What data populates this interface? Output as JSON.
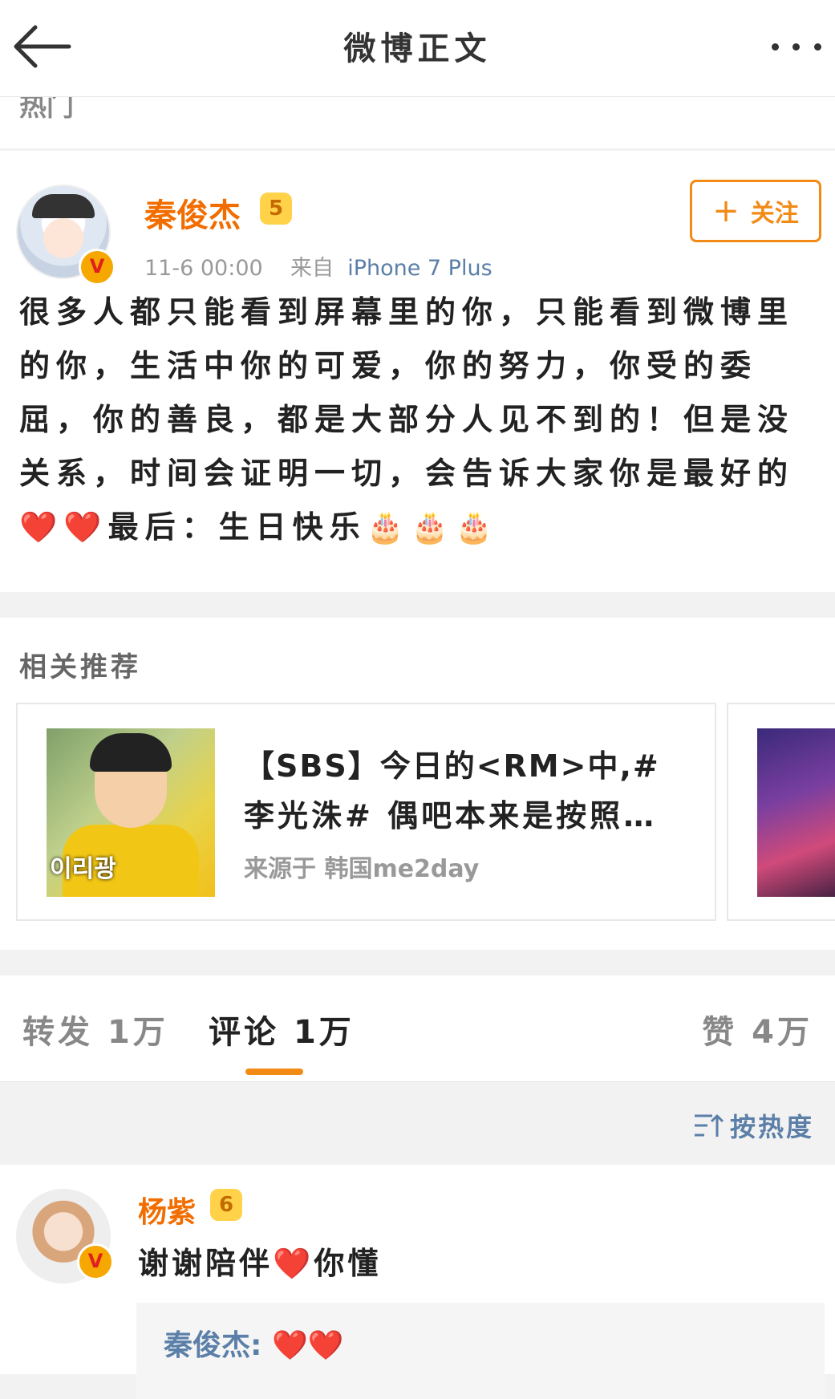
{
  "header": {
    "title": "微博正文"
  },
  "hot_label": "热门",
  "post": {
    "author": "秦俊杰",
    "vip_level": "5",
    "verified_mark": "V",
    "time": "11-6 00:00",
    "source_prefix": "来自",
    "source": "iPhone 7 Plus",
    "follow_label": "关注",
    "text": "很多人都只能看到屏幕里的你，只能看到微博里的你，生活中你的可爱，你的努力，你受的委屈，你的善良，都是大部分人见不到的！但是没关系，时间会证明一切，会告诉大家你是最好的❤️❤️最后：生日快乐🎂🎂🎂"
  },
  "related": {
    "title": "相关推荐",
    "card": {
      "line1": "【SBS】今日的<RM>中,#",
      "line2": "李光洙# 偶吧本来是按照…",
      "source": "来源于 韩国me2day",
      "thumb_caption": "이리광"
    }
  },
  "tabs": [
    {
      "label": "转发",
      "count": "1万"
    },
    {
      "label": "评论",
      "count": "1万"
    },
    {
      "label": "赞",
      "count": "4万"
    }
  ],
  "sort": {
    "label": "按热度"
  },
  "comment": {
    "author": "杨紫",
    "vip_level": "6",
    "verified_mark": "V",
    "text": "谢谢陪伴❤️你懂",
    "reply": {
      "author": "秦俊杰",
      "separator": ":",
      "text": "❤️❤️"
    }
  },
  "colors": {
    "accent": "#f28a16",
    "name": "#f26d00",
    "link": "#5b7fa8"
  }
}
